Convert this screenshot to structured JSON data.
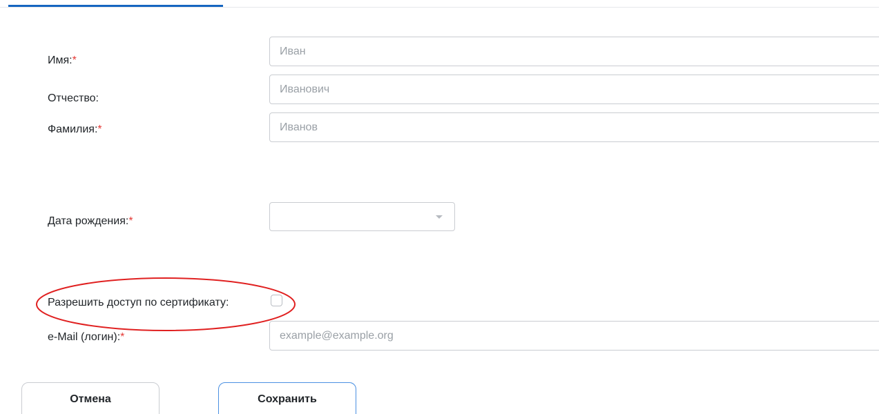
{
  "form": {
    "first_name": {
      "label": "Имя:",
      "required_mark": "*",
      "placeholder": "Иван",
      "value": ""
    },
    "patronymic": {
      "label": "Отчество:",
      "placeholder": "Иванович",
      "value": ""
    },
    "last_name": {
      "label": "Фамилия:",
      "required_mark": "*",
      "placeholder": "Иванов",
      "value": ""
    },
    "birth_date": {
      "label": "Дата рождения:",
      "required_mark": "*",
      "selected": ""
    },
    "certificate_access": {
      "label": "Разрешить доступ по сертификату:",
      "checked": false
    },
    "email": {
      "label": "e-Mail (логин):",
      "required_mark": "*",
      "placeholder": "example@example.org",
      "value": ""
    }
  },
  "actions": {
    "cancel_label": "Отмена",
    "save_label": "Сохранить"
  },
  "colors": {
    "accent": "#1565c0",
    "required": "#e53935",
    "annotation": "#e02020",
    "save_border": "#4a90e2"
  },
  "icons": {
    "dropdown": "chevron-down-icon"
  }
}
